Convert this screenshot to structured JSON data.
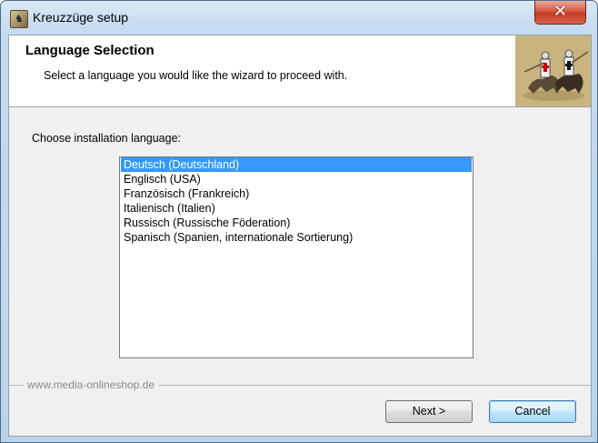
{
  "window": {
    "title": "Kreuzzüge setup",
    "close_label": "✕"
  },
  "header": {
    "title": "Language Selection",
    "subtitle": "Select a language you would like the wizard to proceed with."
  },
  "prompt": "Choose installation language:",
  "languages": {
    "selected_index": 0,
    "items": [
      "Deutsch (Deutschland)",
      "Englisch (USA)",
      "Französisch (Frankreich)",
      "Italienisch (Italien)",
      "Russisch (Russische Föderation)",
      "Spanisch (Spanien, internationale Sortierung)"
    ]
  },
  "branding": "www.media-onlineshop.de",
  "buttons": {
    "next": "Next >",
    "cancel": "Cancel"
  },
  "colors": {
    "selection": "#3399ff",
    "close_button": "#c43b25"
  },
  "icons": {
    "app": "knight-icon",
    "header_image": "crusader-knights-image"
  }
}
